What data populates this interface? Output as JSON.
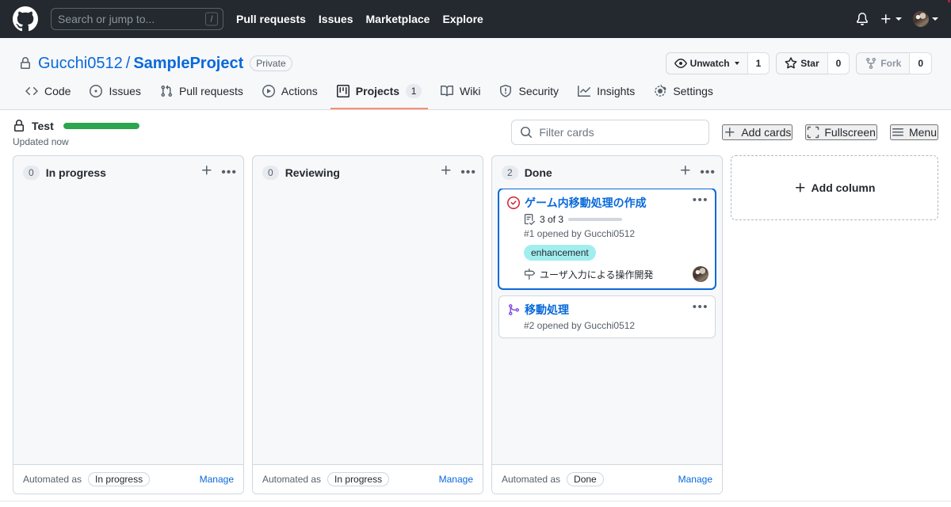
{
  "header": {
    "logo_icon": "github-mark-icon",
    "search_placeholder": "Search or jump to...",
    "search_shortcut": "/",
    "nav": [
      {
        "label": "Pull requests"
      },
      {
        "label": "Issues"
      },
      {
        "label": "Marketplace"
      },
      {
        "label": "Explore"
      }
    ],
    "bell_icon": "notification-bell-icon",
    "plus_icon": "plus-icon",
    "avatar_icon": "user-avatar"
  },
  "repo": {
    "lock_icon": "lock-icon",
    "owner": "Gucchi0512",
    "separator": "/",
    "name": "SampleProject",
    "visibility": "Private",
    "actions": {
      "watch_label": "Unwatch",
      "watch_count": "1",
      "star_label": "Star",
      "star_count": "0",
      "fork_label": "Fork",
      "fork_count": "0"
    },
    "tabs": [
      {
        "label": "Code",
        "icon": "code-icon",
        "counter": "",
        "selected": false
      },
      {
        "label": "Issues",
        "icon": "issue-opened-icon",
        "counter": "",
        "selected": false
      },
      {
        "label": "Pull requests",
        "icon": "git-pull-request-icon",
        "counter": "",
        "selected": false
      },
      {
        "label": "Actions",
        "icon": "play-icon",
        "counter": "",
        "selected": false
      },
      {
        "label": "Projects",
        "icon": "project-board-icon",
        "counter": "1",
        "selected": true
      },
      {
        "label": "Wiki",
        "icon": "book-icon",
        "counter": "",
        "selected": false
      },
      {
        "label": "Security",
        "icon": "shield-icon",
        "counter": "",
        "selected": false
      },
      {
        "label": "Insights",
        "icon": "graph-icon",
        "counter": "",
        "selected": false
      },
      {
        "label": "Settings",
        "icon": "gear-icon",
        "counter": "",
        "selected": false
      }
    ]
  },
  "project": {
    "lock_icon": "lock-icon",
    "name": "Test",
    "progress_percent": 100,
    "updated": "Updated now",
    "filter_placeholder": "Filter cards",
    "filter_value": "",
    "search_icon": "search-icon",
    "toolbar": [
      {
        "label": "Add cards",
        "icon": "plus-icon"
      },
      {
        "label": "Fullscreen",
        "icon": "fullscreen-icon"
      },
      {
        "label": "Menu",
        "icon": "hamburger-menu-icon"
      }
    ]
  },
  "columns": [
    {
      "count": "0",
      "title": "In progress",
      "add_icon": "plus-icon",
      "more_icon": "kebab-horizontal-icon",
      "cards": [],
      "footer": {
        "prefix": "Automated as",
        "chip": "In progress",
        "manage": "Manage"
      }
    },
    {
      "count": "0",
      "title": "Reviewing",
      "add_icon": "plus-icon",
      "more_icon": "kebab-horizontal-icon",
      "cards": [],
      "footer": {
        "prefix": "Automated as",
        "chip": "In progress",
        "manage": "Manage"
      }
    },
    {
      "count": "2",
      "title": "Done",
      "add_icon": "plus-icon",
      "more_icon": "kebab-horizontal-icon",
      "cards": [
        {
          "state_icon": "issue-closed-not-planned-icon",
          "state_color": "#cf222e",
          "title": "ゲーム内移動処理の作成",
          "focused": true,
          "tasklist": {
            "icon": "tasklist-icon",
            "text": "3 of 3",
            "completed": 3,
            "total": 3
          },
          "meta": "#1 opened by Gucchi0512",
          "labels": [
            {
              "name": "enhancement",
              "color": "#a2eeef"
            }
          ],
          "milestone": {
            "icon": "milestone-icon",
            "text": "ユーザ入力による操作開発"
          },
          "assignee_icon": "assignee-avatar",
          "more_icon": "kebab-horizontal-icon"
        },
        {
          "state_icon": "git-merge-icon",
          "state_color": "#8250df",
          "title": "移動処理",
          "focused": false,
          "meta": "#2 opened by Gucchi0512",
          "more_icon": "kebab-horizontal-icon"
        }
      ],
      "footer": {
        "prefix": "Automated as",
        "chip": "Done",
        "manage": "Manage"
      }
    }
  ],
  "add_column": {
    "label": "Add column",
    "icon": "plus-icon"
  }
}
